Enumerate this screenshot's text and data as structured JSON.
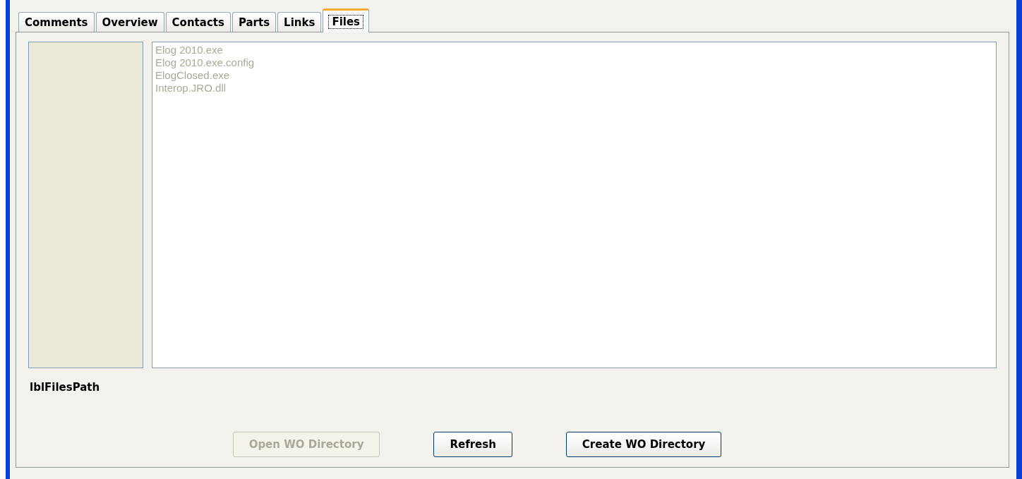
{
  "tabs": [
    {
      "label": "Comments",
      "selected": false
    },
    {
      "label": "Overview",
      "selected": false
    },
    {
      "label": "Contacts",
      "selected": false
    },
    {
      "label": "Parts",
      "selected": false
    },
    {
      "label": "Links",
      "selected": false
    },
    {
      "label": "Files",
      "selected": true
    }
  ],
  "file_list": {
    "disabled": true,
    "items": [
      "Elog 2010.exe",
      "Elog 2010.exe.config",
      "ElogClosed.exe",
      "Interop.JRO.dll"
    ]
  },
  "path_label": "lblFilesPath",
  "buttons": [
    {
      "label": "Open WO Directory",
      "disabled": true
    },
    {
      "label": "Refresh",
      "disabled": false
    },
    {
      "label": "Create WO Directory",
      "disabled": false
    }
  ]
}
